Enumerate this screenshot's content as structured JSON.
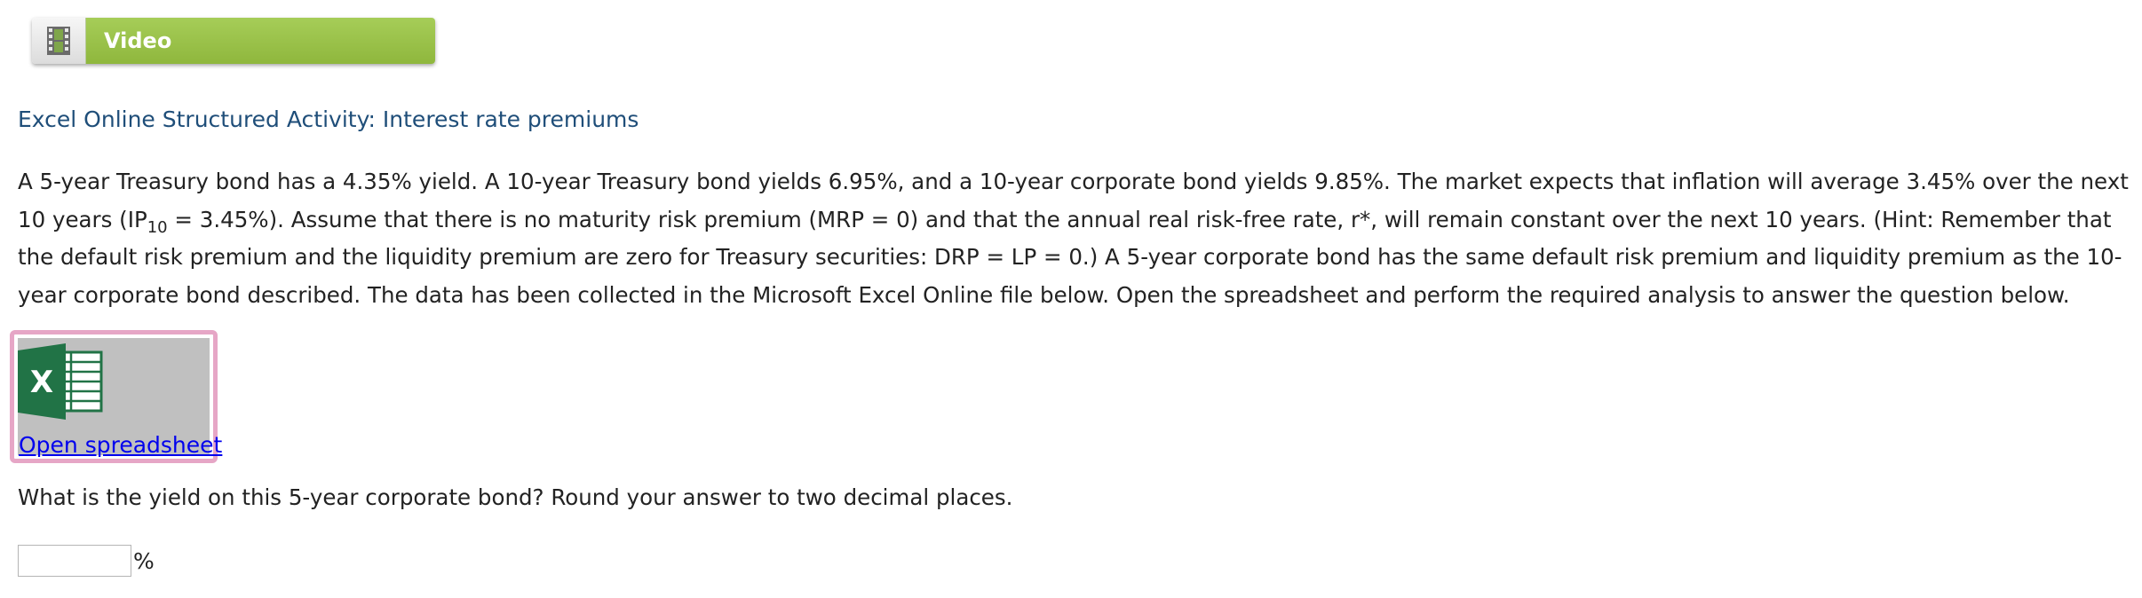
{
  "video_button": {
    "label": "Video",
    "icon": "film-icon"
  },
  "activity": {
    "title": "Excel Online Structured Activity: Interest rate premiums"
  },
  "problem": {
    "part1": "A 5-year Treasury bond has a 4.35% yield. A 10-year Treasury bond yields 6.95%, and a 10-year corporate bond yields 9.85%. The market expects that inflation will average 3.45% over the next 10 years (IP",
    "subscript": "10",
    "part2": " = 3.45%). Assume that there is no maturity risk premium (MRP = 0) and that the annual real risk-free rate, r*, will remain constant over the next 10 years. (Hint: Remember that the default risk premium and the liquidity premium are zero for Treasury securities: DRP = LP = 0.) A 5-year corporate bond has the same default risk premium and liquidity premium as the 10-year corporate bond described. The data has been collected in the Microsoft Excel Online file below. Open the spreadsheet and perform the required analysis to answer the question below."
  },
  "spreadsheet": {
    "icon": "excel-icon",
    "link_label": "Open spreadsheet"
  },
  "question": {
    "text": "What is the yield on this 5-year corporate bond? Round your answer to two decimal places."
  },
  "answer": {
    "value": "",
    "unit": "%"
  },
  "colors": {
    "video_green": "#9cc34a",
    "title_blue": "#1f4e79",
    "link_blue": "#0000ee",
    "highlight_pink": "#e6a6c6",
    "sheet_gray": "#c0c0c0",
    "excel_green": "#217346"
  }
}
